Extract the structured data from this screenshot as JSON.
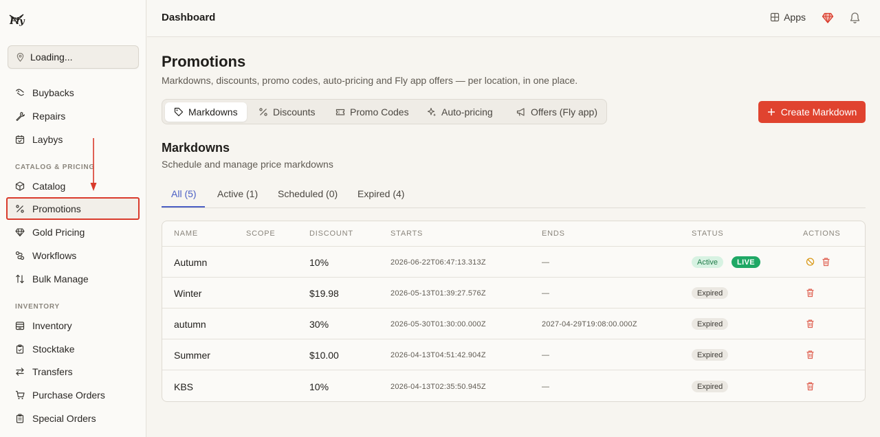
{
  "brand": {
    "logo_text": "Fly",
    "accent": "#e0432f",
    "tab_accent": "#4a5ec4"
  },
  "location": {
    "label": "Loading..."
  },
  "sidebar": {
    "items_top": [
      {
        "label": "Buybacks",
        "icon": "buyback-icon"
      },
      {
        "label": "Repairs",
        "icon": "wrench-icon"
      },
      {
        "label": "Laybys",
        "icon": "calendar-icon"
      }
    ],
    "section_catalog": "CATALOG & PRICING",
    "items_catalog": [
      {
        "label": "Catalog",
        "icon": "box-icon"
      },
      {
        "label": "Promotions",
        "icon": "percent-icon"
      },
      {
        "label": "Gold Pricing",
        "icon": "gem-icon"
      },
      {
        "label": "Workflows",
        "icon": "workflow-icon"
      },
      {
        "label": "Bulk Manage",
        "icon": "sort-icon"
      }
    ],
    "section_inventory": "INVENTORY",
    "items_inventory": [
      {
        "label": "Inventory",
        "icon": "archive-icon"
      },
      {
        "label": "Stocktake",
        "icon": "clipboard-icon"
      },
      {
        "label": "Transfers",
        "icon": "transfer-icon"
      },
      {
        "label": "Purchase Orders",
        "icon": "cart-icon"
      },
      {
        "label": "Special Orders",
        "icon": "clipboard-list-icon"
      }
    ]
  },
  "header": {
    "title": "Dashboard",
    "apps_label": "Apps"
  },
  "page": {
    "title": "Promotions",
    "subtitle": "Markdowns, discounts, promo codes, auto-pricing and Fly app offers — per location, in one place.",
    "tabs": [
      {
        "label": "Markdowns",
        "icon": "tag-icon"
      },
      {
        "label": "Discounts",
        "icon": "percent-icon"
      },
      {
        "label": "Promo Codes",
        "icon": "ticket-icon"
      },
      {
        "label": "Auto-pricing",
        "icon": "sparkle-icon"
      },
      {
        "label": "Offers (Fly app)",
        "icon": "megaphone-icon"
      }
    ],
    "create_label": "Create Markdown"
  },
  "section": {
    "title": "Markdowns",
    "subtitle": "Schedule and manage price markdowns",
    "filters": [
      "All (5)",
      "Active (1)",
      "Scheduled (0)",
      "Expired (4)"
    ]
  },
  "table": {
    "columns": [
      "NAME",
      "SCOPE",
      "DISCOUNT",
      "STARTS",
      "ENDS",
      "STATUS",
      "ACTIONS"
    ],
    "rows": [
      {
        "name": "Autumn",
        "scope": "",
        "discount": "10%",
        "starts": "2026-06-22T06:47:13.313Z",
        "ends": "—",
        "status": "Active",
        "live": "LIVE"
      },
      {
        "name": "Winter",
        "scope": "",
        "discount": "$19.98",
        "starts": "2026-05-13T01:39:27.576Z",
        "ends": "—",
        "status": "Expired"
      },
      {
        "name": "autumn",
        "scope": "",
        "discount": "30%",
        "starts": "2026-05-30T01:30:00.000Z",
        "ends": "2027-04-29T19:08:00.000Z",
        "status": "Expired"
      },
      {
        "name": "Summer",
        "scope": "",
        "discount": "$10.00",
        "starts": "2026-04-13T04:51:42.904Z",
        "ends": "—",
        "status": "Expired"
      },
      {
        "name": "KBS",
        "scope": "",
        "discount": "10%",
        "starts": "2026-04-13T02:35:50.945Z",
        "ends": "—",
        "status": "Expired"
      }
    ]
  }
}
